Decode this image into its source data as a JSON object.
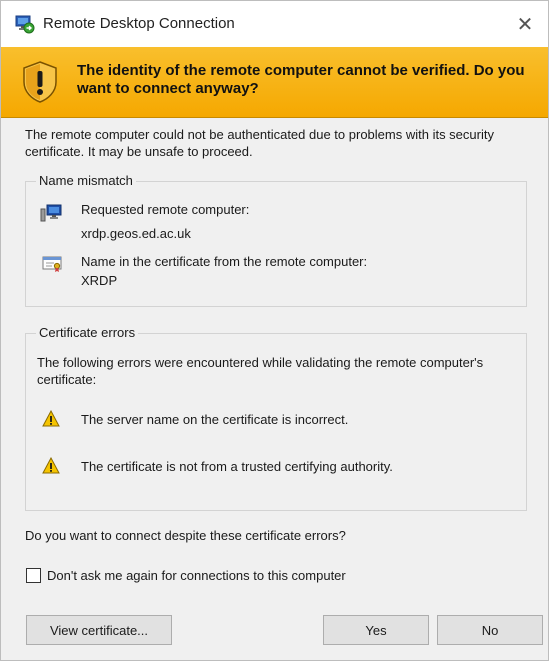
{
  "window": {
    "title": "Remote Desktop Connection",
    "close_glyph": "✕"
  },
  "banner": {
    "message": "The identity of the remote computer cannot be verified. Do you want to connect anyway?",
    "icon": "shield-warning-icon",
    "color": "#f5a800"
  },
  "intro": "The remote computer could not be authenticated due to problems with its security certificate. It may be unsafe to proceed.",
  "name_mismatch": {
    "legend": "Name mismatch",
    "requested_label": "Requested remote computer:",
    "requested_value": "xrdp.geos.ed.ac.uk",
    "cert_label": "Name in the certificate from the remote computer:",
    "cert_value": "XRDP"
  },
  "certificate_errors": {
    "legend": "Certificate errors",
    "description": "The following errors were encountered while validating the remote computer's certificate:",
    "errors": [
      "The server name on the certificate is incorrect.",
      "The certificate is not from a trusted certifying authority."
    ]
  },
  "question": "Do you want to connect despite these certificate errors?",
  "dont_ask": {
    "label": "Don't ask me again for connections to this computer",
    "checked": false
  },
  "buttons": {
    "view_certificate": "View certificate...",
    "yes": "Yes",
    "no": "No"
  }
}
